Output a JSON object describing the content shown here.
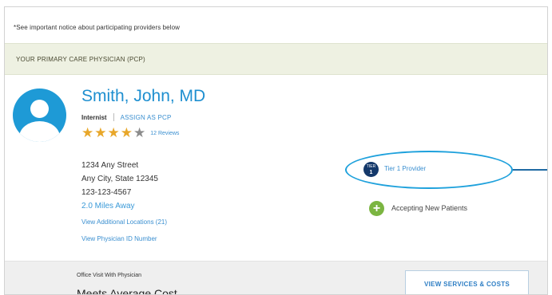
{
  "notice": "*See important notice about participating providers below",
  "pcp_banner": "YOUR PRIMARY CARE PHYSICIAN (PCP)",
  "physician": {
    "name": "Smith, John, MD",
    "specialty": "Internist",
    "assign_link": "ASSIGN AS PCP",
    "rating": 4,
    "rating_max": 5,
    "reviews_link": "12 Reviews",
    "address": [
      "1234 Any Street",
      "Any City, State  12345"
    ],
    "phone": "123-123-4567",
    "distance": "2.0 Miles Away",
    "additional_locations_link": "View Additional Locations (21)",
    "physician_id_link": "View Physician ID Number"
  },
  "tier": {
    "badge_text": "TIER\n1",
    "label": "Tier 1 Provider"
  },
  "accepting": {
    "icon_glyph": "+",
    "label": "Accepting New Patients"
  },
  "cost": {
    "title": "Office Visit With Physician",
    "value": "Meets Average Cost",
    "button_label": "VIEW SERVICES & COSTS"
  },
  "colors": {
    "brand_blue": "#1e8fd0",
    "star_gold": "#e8a72a",
    "star_gray": "#8c8c8c",
    "tier_navy": "#14386a",
    "accept_green": "#7bb541",
    "highlight_ellipse": "#1ea1dc",
    "pcp_banner_bg": "#eef1e2"
  },
  "icons": {
    "avatar": "person-silhouette-icon",
    "star": "star-icon",
    "tier": "tier-badge-icon",
    "accepting": "plus-circle-icon"
  }
}
